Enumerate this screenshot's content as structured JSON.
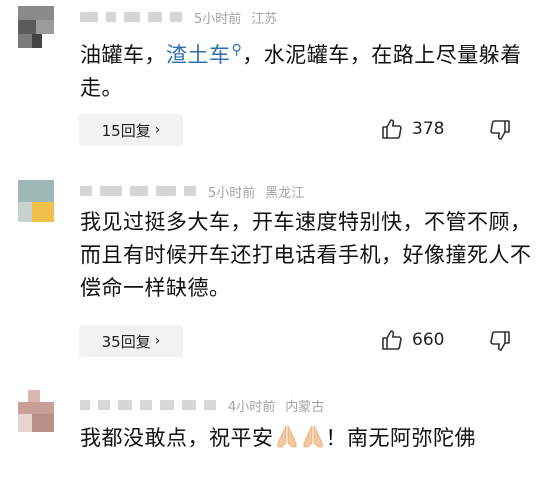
{
  "comments": [
    {
      "time": "5小时前",
      "location": "江苏",
      "text_prefix": "油罐车，",
      "link_text": "渣土车",
      "text_suffix": "，水泥罐车，在路上尽量躲着走。",
      "reply_label": "15回复",
      "likes": "378"
    },
    {
      "time": "5小时前",
      "location": "黑龙江",
      "text": "我见过挺多大车，开车速度特别快，不管不顾，而且有时候开车还打电话看手机，好像撞死人不偿命一样缺德。",
      "reply_label": "35回复",
      "likes": "660"
    },
    {
      "time": "4小时前",
      "location": "内蒙古",
      "text_prefix": "我都没敢点，祝平安",
      "text_suffix": "！南无阿弥陀佛",
      "emoji": "praying-hands"
    }
  ],
  "icons": {
    "like": "thumbs-up-icon",
    "dislike": "thumbs-down-icon",
    "reply_chevron": "chevron-right-icon",
    "search": "search-icon"
  },
  "colors": {
    "link": "#2f6fb0",
    "meta": "#a3a3a3",
    "button_bg": "#f2f2f2"
  }
}
